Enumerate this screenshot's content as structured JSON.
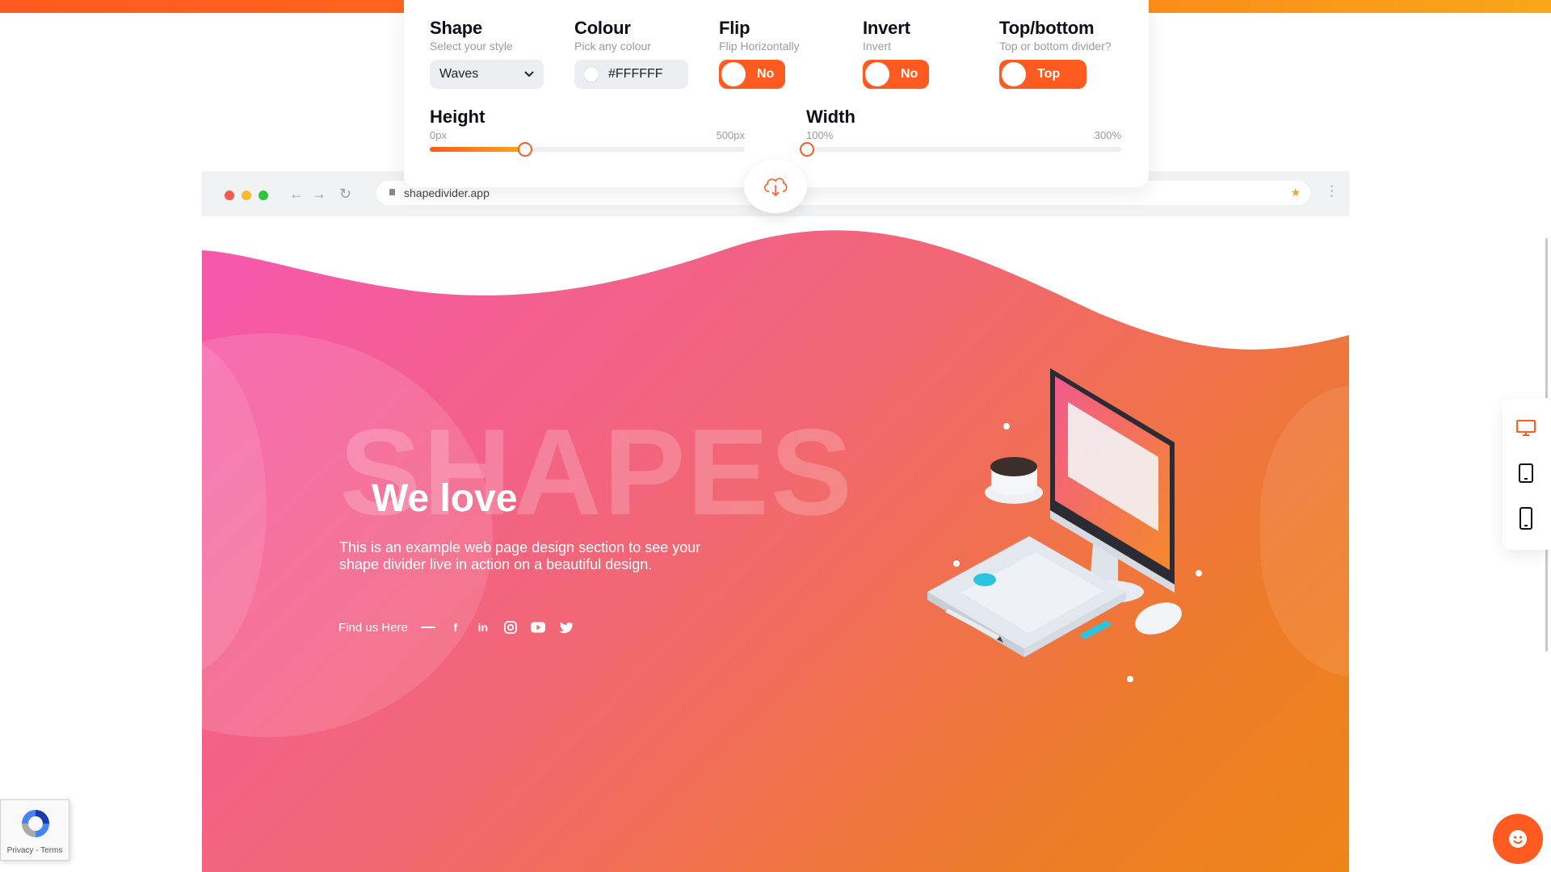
{
  "colors": {
    "accent": "#ff5a1f",
    "accent_end": "#f8a71a",
    "hero_start": "#f657b0",
    "hero_end": "#ee8518"
  },
  "controls": {
    "shape": {
      "title": "Shape",
      "subtitle": "Select your style",
      "value": "Waves"
    },
    "colour": {
      "title": "Colour",
      "subtitle": "Pick any colour",
      "value": "#FFFFFF"
    },
    "flip": {
      "title": "Flip",
      "subtitle": "Flip Horizontally",
      "value": "No"
    },
    "invert": {
      "title": "Invert",
      "subtitle": "Invert",
      "value": "No"
    },
    "top_bottom": {
      "title": "Top/bottom",
      "subtitle": "Top or bottom divider?",
      "value": "Top"
    },
    "height": {
      "title": "Height",
      "min": "0px",
      "max": "500px",
      "value_fraction": 0.3
    },
    "width": {
      "title": "Width",
      "min": "100%",
      "max": "300%",
      "value_fraction": 0.0
    }
  },
  "browser": {
    "url": "shapedivider.app"
  },
  "hero": {
    "watermark": "SHAPES",
    "heading": "We love",
    "description": "This is an example web page design section to see your shape divider live in action on a beautiful design.",
    "find_us": "Find us Here"
  },
  "icons": [
    "download-cloud-icon",
    "facebook-icon",
    "linkedin-icon",
    "instagram-icon",
    "youtube-icon",
    "twitter-icon",
    "desktop-icon",
    "tablet-icon",
    "phone-icon",
    "recaptcha-icon",
    "chat-smiley-icon"
  ],
  "recaptcha": {
    "links": "Privacy - Terms"
  }
}
